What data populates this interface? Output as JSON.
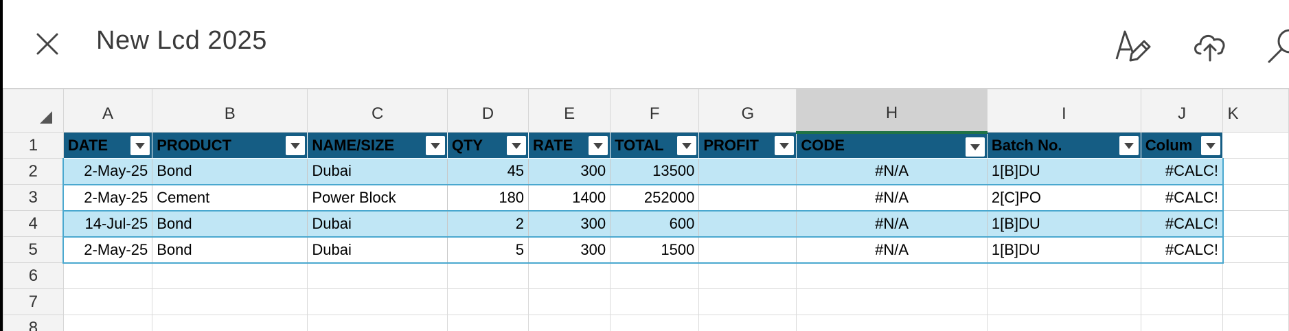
{
  "window": {
    "title": "New Lcd 2025"
  },
  "toolbar": {
    "close_icon": "close-icon",
    "edit_icon": "pen-edit-icon",
    "upload_icon": "cloud-upload-icon",
    "search_icon": "search-icon"
  },
  "columns": [
    "A",
    "B",
    "C",
    "D",
    "E",
    "F",
    "G",
    "H",
    "I",
    "J",
    "K"
  ],
  "selected_column": "H",
  "rows": [
    "1",
    "2",
    "3",
    "4",
    "5",
    "6",
    "7",
    "8"
  ],
  "table": {
    "headers": [
      "DATE",
      "PRODUCT",
      "NAME/SIZE",
      "QTY",
      "RATE",
      "TOTAL",
      "PROFIT",
      "CODE",
      "Batch No.",
      "Colum"
    ],
    "records": [
      [
        "2-May-25",
        "Bond",
        "Dubai",
        "45",
        "300",
        "13500",
        "",
        "#N/A",
        "1[B]DU",
        "#CALC!"
      ],
      [
        "2-May-25",
        "Cement",
        "Power Block",
        "180",
        "1400",
        "252000",
        "",
        "#N/A",
        "2[C]PO",
        "#CALC!"
      ],
      [
        "14-Jul-25",
        "Bond",
        "Dubai",
        "2",
        "300",
        "600",
        "",
        "#N/A",
        "1[B]DU",
        "#CALC!"
      ],
      [
        "2-May-25",
        "Bond",
        "Dubai",
        "5",
        "300",
        "1500",
        "",
        "#N/A",
        "1[B]DU",
        "#CALC!"
      ]
    ]
  },
  "colors": {
    "table_header": "#155d84",
    "band_row": "#c0e6f5",
    "table_border": "#4aa8cf",
    "selection_accent": "#217346"
  }
}
